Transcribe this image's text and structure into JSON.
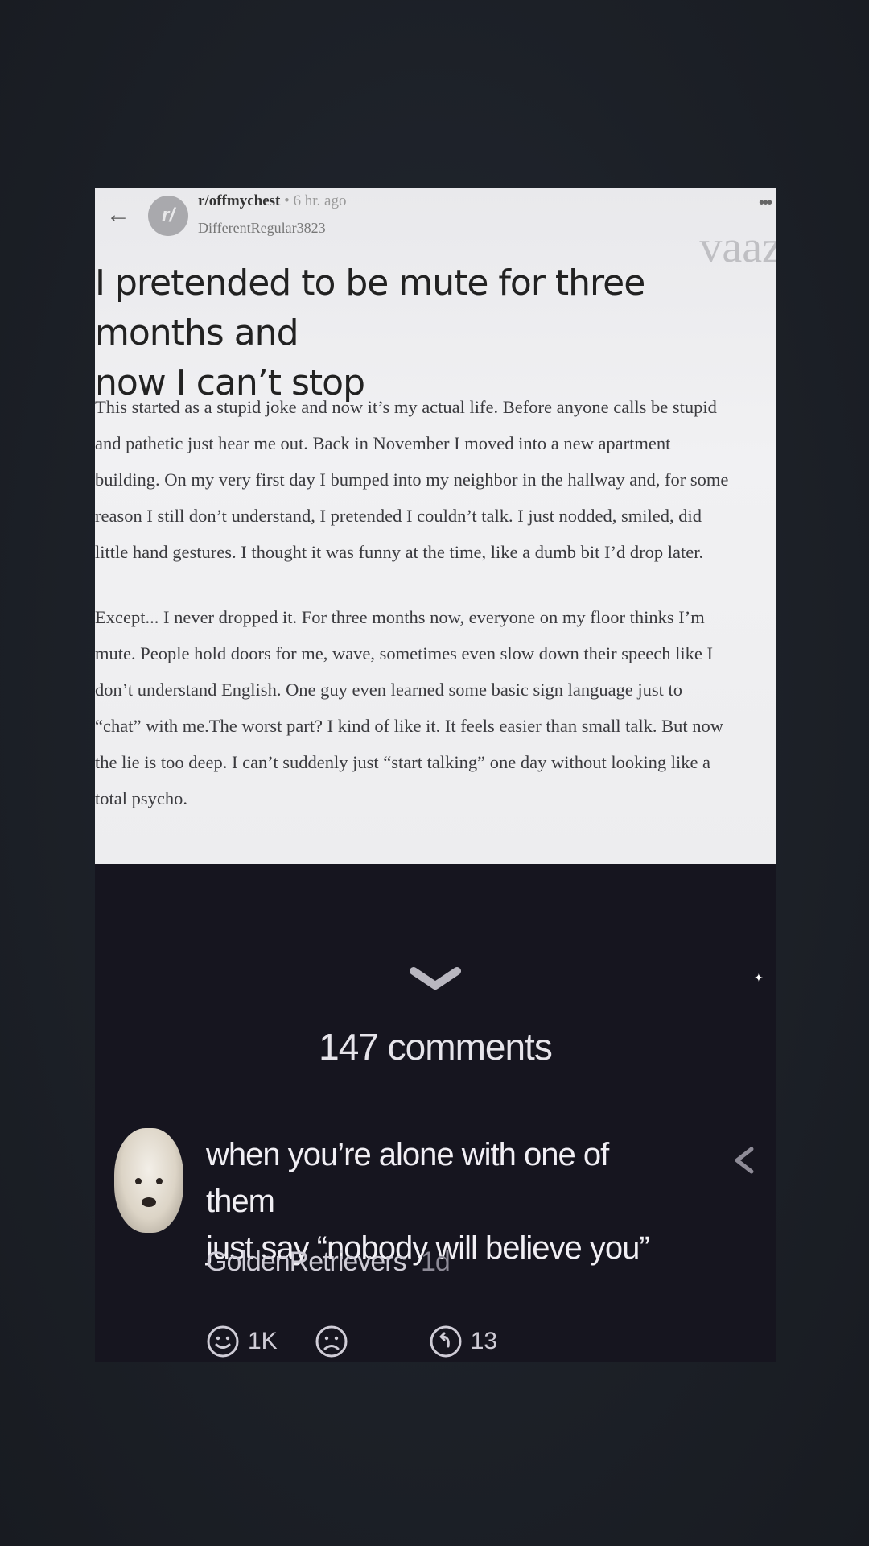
{
  "post": {
    "subreddit": "r/offmychest",
    "time": "• 6 hr. ago",
    "username": "DifferentRegular3823",
    "sub_avatar_letter": "r/",
    "watermark": "vaaz",
    "title_lines": [
      "I pretended to be mute for three months and",
      "now I can’t stop"
    ],
    "paragraph1_lines": [
      "This started as a stupid joke and now it’s my actual life. Before anyone calls be stupid",
      "and pathetic just hear me out. Back in November I moved into a new apartment",
      "building. On my very first day I bumped into my neighbor in the hallway and, for some",
      "reason I still don’t understand, I pretended I couldn’t talk. I just nodded, smiled, did",
      "little hand gestures. I thought it was funny at the time, like a dumb bit I’d drop later."
    ],
    "paragraph2_lines": [
      "Except... I never dropped it. For three months now, everyone on my floor thinks I’m",
      "mute. People hold doors for me, wave, sometimes even slow down their speech like I",
      "don’t understand English. One guy even learned some basic sign language just to",
      "“chat” with me.The worst part? I kind of like it. It feels easier than small talk. But now",
      "the lie is too deep. I can’t suddenly just “start talking” one day without looking like a",
      "total psycho."
    ]
  },
  "comments": {
    "count_label": "147 comments",
    "top_comment": {
      "text_lines": [
        "when you’re alone with one of them",
        "just say “nobody will believe you”"
      ],
      "author": "GoldenRetrievers",
      "age": "1d",
      "likes": "1K",
      "replies": "13"
    }
  },
  "icons": {
    "back": "back-arrow-icon",
    "more": "more-dots-icon",
    "expand": "chevron-down-icon",
    "share": "share-icon",
    "like": "smile-icon",
    "dislike": "frown-icon",
    "reply": "reply-icon"
  },
  "colors": {
    "post_background": "#eeeef0",
    "comments_background": "#16151f",
    "page_background": "#1e2229"
  }
}
